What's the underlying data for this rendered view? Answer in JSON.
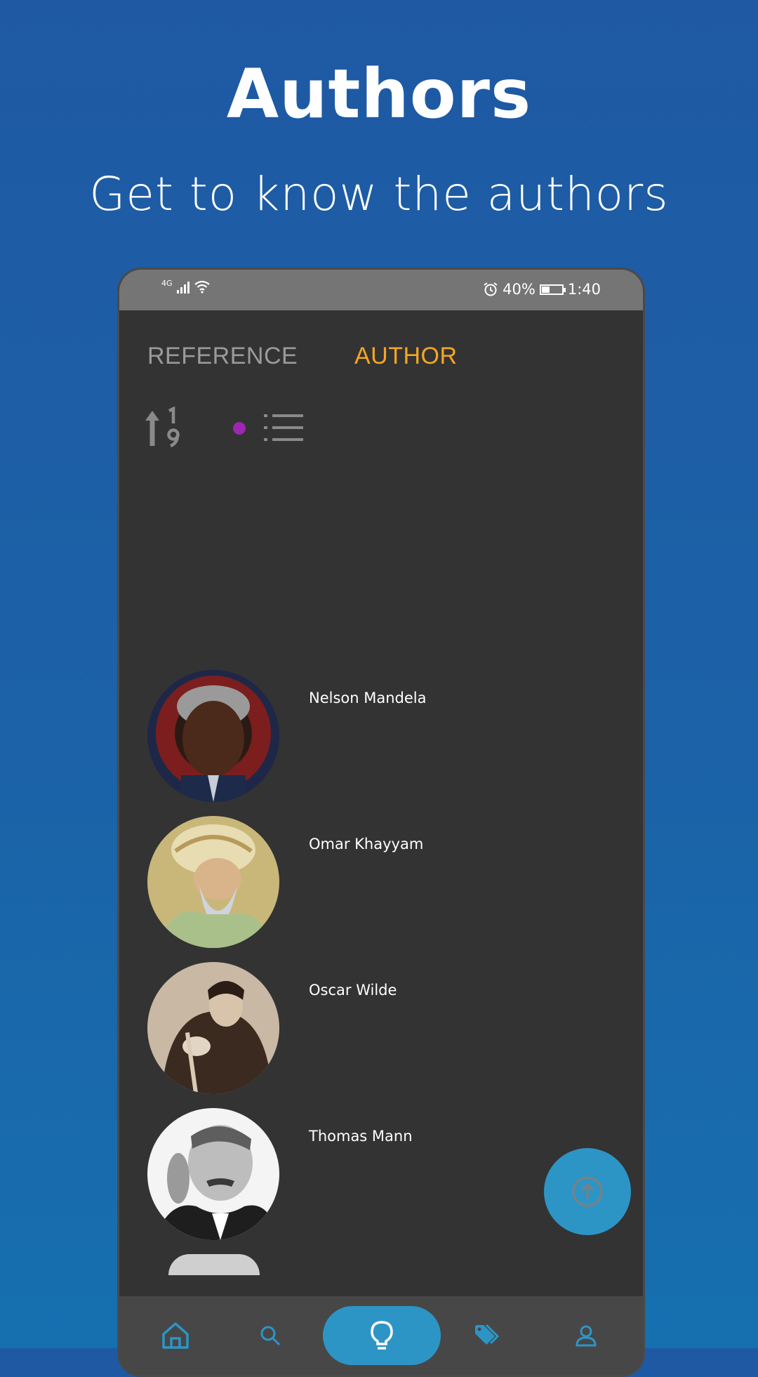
{
  "promo": {
    "title": "Authors",
    "subtitle": "Get to know the authors"
  },
  "status_bar": {
    "network": "4G",
    "alarm_icon": "alarm-icon",
    "battery_percent": "40%",
    "battery_level": 0.4,
    "time": "1:40"
  },
  "tabs": [
    {
      "label": "REFERENCE",
      "active": false
    },
    {
      "label": "AUTHOR",
      "active": true
    }
  ],
  "toolbar": {
    "sort_icon": "sort-numeric-icon",
    "view_icon": "list-view-icon",
    "indicator_color": "#9c27b0"
  },
  "authors": [
    {
      "name": "Nelson Mandela"
    },
    {
      "name": "Omar Khayyam"
    },
    {
      "name": "Oscar Wilde"
    },
    {
      "name": "Thomas Mann"
    }
  ],
  "fab": {
    "icon": "arrow-up-circle-icon"
  },
  "bottom_nav": [
    {
      "icon": "home-icon"
    },
    {
      "icon": "search-icon"
    },
    {
      "icon": "lightbulb-icon",
      "active": true
    },
    {
      "icon": "tag-icon"
    },
    {
      "icon": "user-icon"
    }
  ],
  "colors": {
    "accent": "#f5a623",
    "primary": "#2d95c6",
    "background": "#333333"
  }
}
